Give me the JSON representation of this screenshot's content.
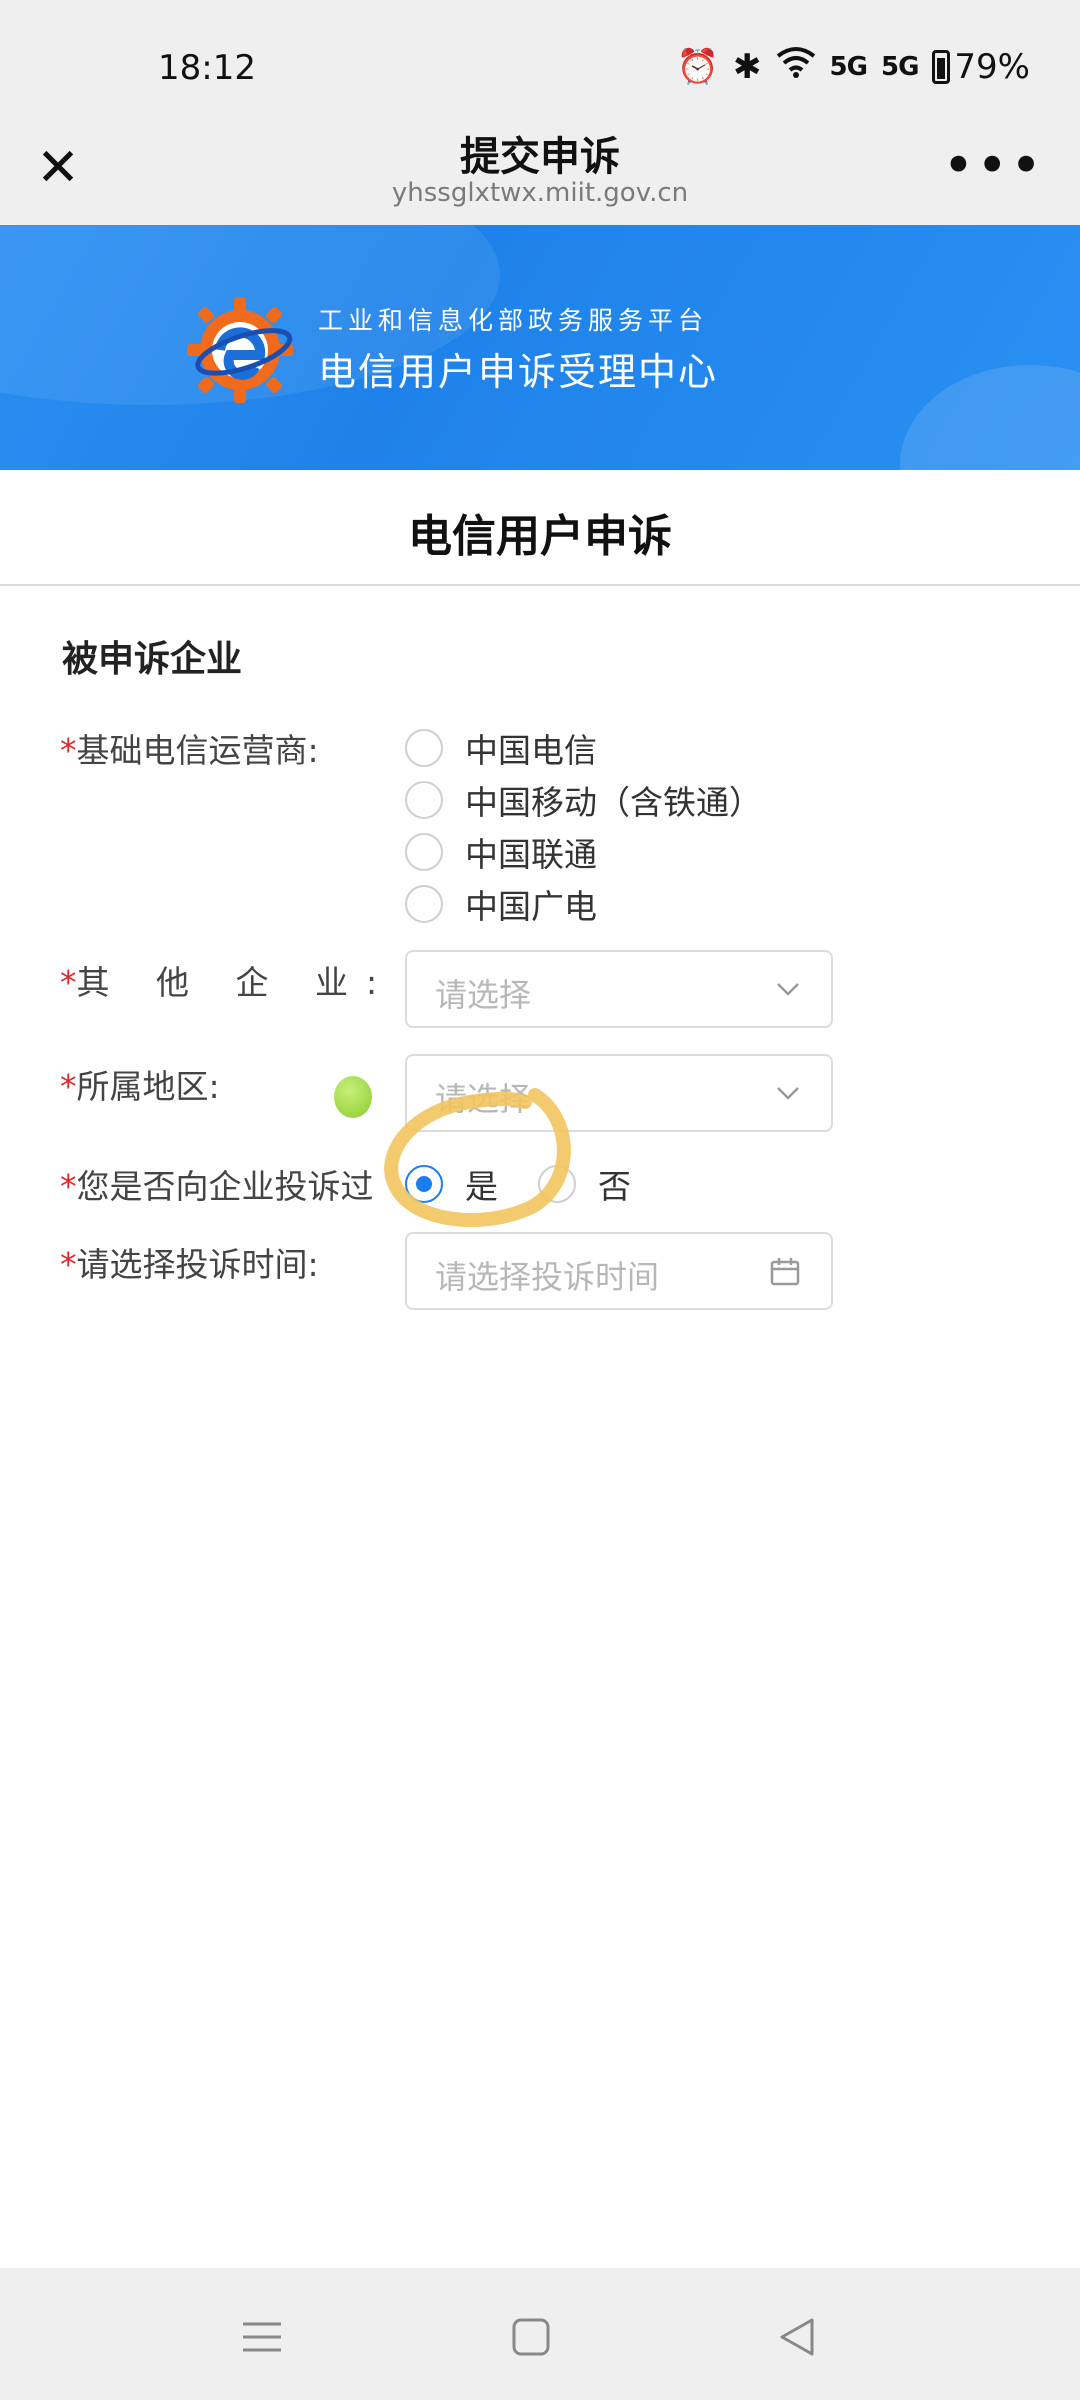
{
  "status_bar": {
    "time": "18:12",
    "signal1": "5G",
    "signal2": "5G",
    "battery": "79%"
  },
  "nav": {
    "title": "提交申诉",
    "url": "yhssglxtwx.miit.gov.cn"
  },
  "banner": {
    "subtitle": "工业和信息化部政务服务平台",
    "title": "电信用户申诉受理中心"
  },
  "page": {
    "title": "电信用户申诉",
    "group_title": "被申诉企业"
  },
  "form": {
    "operator": {
      "required_mark": "*",
      "label": "基础电信运营商:",
      "options": [
        "中国电信",
        "中国移动（含铁通）",
        "中国联通",
        "中国广电"
      ]
    },
    "other_company": {
      "required_mark": "*",
      "label": "其 他 企 业:",
      "placeholder": "请选择"
    },
    "region": {
      "required_mark": "*",
      "label": "所属地区:",
      "placeholder": "请选择"
    },
    "complained_before": {
      "required_mark": "*",
      "label": "您是否向企业投诉过",
      "yes": "是",
      "no": "否",
      "selected": "是"
    },
    "complaint_time": {
      "required_mark": "*",
      "label": "请选择投诉时间:",
      "placeholder": "请选择投诉时间"
    }
  },
  "colors": {
    "accent": "#1a7ef0",
    "required": "#e0282e",
    "banner": "#1e82ea",
    "annotation": "#f2c45e"
  }
}
